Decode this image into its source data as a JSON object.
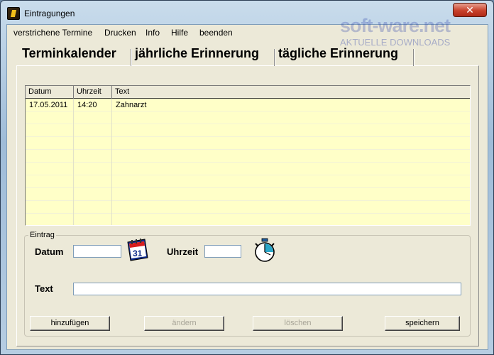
{
  "window": {
    "title": "Eintragungen",
    "close_glyph": "✕"
  },
  "watermark": {
    "main": "soft-ware.net",
    "sub": "AKTUELLE DOWNLOADS"
  },
  "menu": [
    {
      "label": "verstrichene Termine"
    },
    {
      "label": "Drucken"
    },
    {
      "label": "Info"
    },
    {
      "label": "Hilfe"
    },
    {
      "label": "beenden"
    }
  ],
  "tabs": [
    {
      "label": "Terminkalender",
      "active": true
    },
    {
      "label": "jährliche Erinnerung",
      "active": false
    },
    {
      "label": "tägliche Erinnerung",
      "active": false
    }
  ],
  "table": {
    "columns": [
      "Datum",
      "Uhrzeit",
      "Text"
    ],
    "rows": [
      [
        "17.05.2011",
        "14:20",
        "Zahnarzt"
      ]
    ]
  },
  "entry": {
    "legend": "Eintrag",
    "datum_label": "Datum",
    "datum_value": "",
    "uhrzeit_label": "Uhrzeit",
    "uhrzeit_value": "",
    "text_label": "Text",
    "text_value": "",
    "calendar_icon": "calendar-icon",
    "calendar_day": "31",
    "clock_icon": "stopwatch-icon"
  },
  "buttons": {
    "add": "hinzufügen",
    "change": "ändern",
    "delete": "löschen",
    "save": "speichern"
  },
  "colors": {
    "list_background": "#ffffc8",
    "window_face": "#ece9d8",
    "close_button": "#c8422c"
  }
}
